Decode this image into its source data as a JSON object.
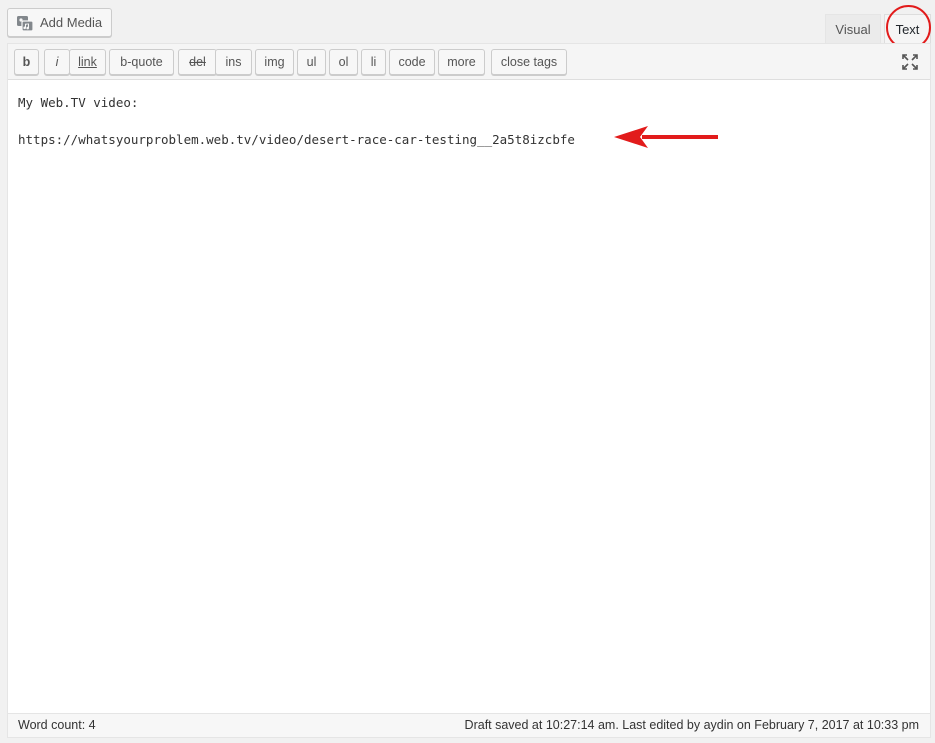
{
  "media": {
    "add_media_label": "Add Media"
  },
  "tabs": {
    "visual_label": "Visual",
    "text_label": "Text",
    "active": "Text"
  },
  "toolbar": {
    "buttons": [
      "b",
      "i",
      "link",
      "b-quote",
      "del",
      "ins",
      "img",
      "ul",
      "ol",
      "li",
      "code",
      "more",
      "close tags"
    ]
  },
  "content": {
    "line1": "My Web.TV video:",
    "line2": "https://whatsyourproblem.web.tv/video/desert-race-car-testing__2a5t8izcbfe"
  },
  "status": {
    "word_count": "Word count: 4",
    "autosave": "Draft saved at 10:27:14 am. Last edited by aydin on February 7, 2017 at 10:33 pm"
  },
  "colors": {
    "annotation_red": "#e21b1b"
  },
  "icons": {
    "add_media": "media-icon",
    "fullscreen": "fullscreen-icon"
  }
}
